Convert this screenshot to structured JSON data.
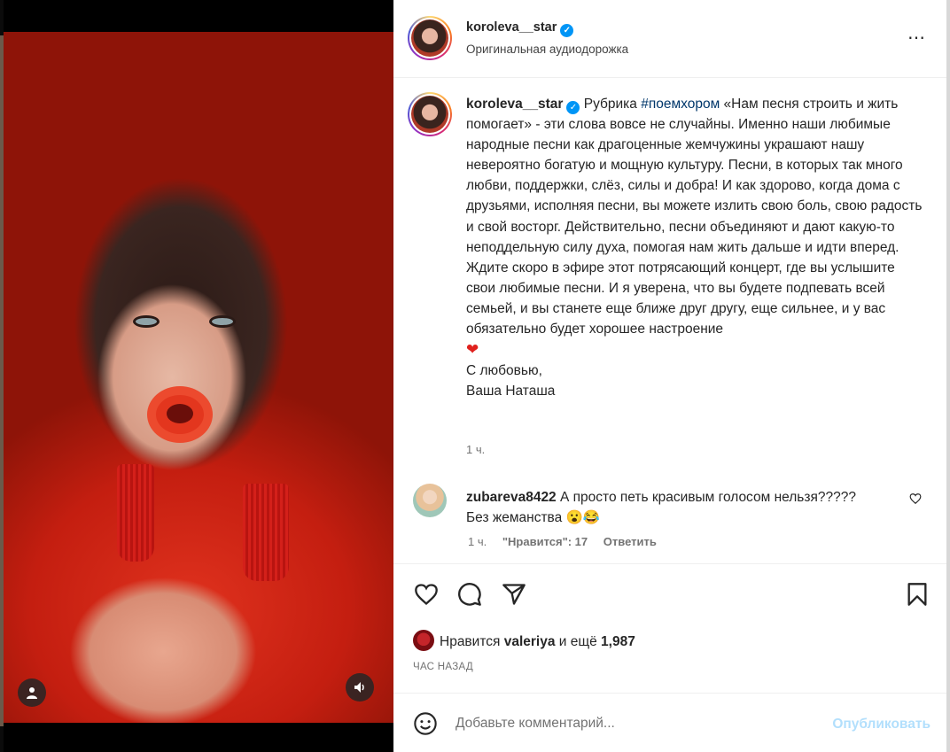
{
  "media": {
    "user_button_icon": "person-icon",
    "sound_button_icon": "speaker-icon"
  },
  "header": {
    "username": "koroleva__star",
    "verified_icon": "verified-badge-icon",
    "audio": "Оригинальная аудиодорожка",
    "more_icon": "more-options-icon",
    "more": "⋯"
  },
  "caption": {
    "username": "koroleva__star",
    "text_before_hashtag": "Рубрика ",
    "hashtag": "#поемхором",
    "text_after_hashtag": " «Нам песня строить и жить помогает» - эти слова вовсе не случайны. Именно наши любимые народные песни как драгоценные жемчужины украшают нашу невероятно богатую и мощную культуру. Песни, в которых так много любви, поддержки, слёз, силы и добра! И как здорово, когда дома с друзьями, исполняя песни, вы можете излить свою боль, свою радость и свой восторг. Действительно, песни объединяют и дают какую-то неподдельную силу духа, помогая нам жить дальше и идти вперед.",
    "paragraph2": "Ждите скоро в эфире этот потрясающий концерт, где вы услышите свои любимые песни. И я уверена, что вы будете подпевать всей семьей, и вы станете еще ближе друг другу, еще сильнее, и у вас обязательно будет хорошее настроение",
    "heart_emoji": "❤",
    "signoff1": "С любовью,",
    "signoff2": "Ваша Наташа",
    "time": "1 ч."
  },
  "comment": {
    "username": "zubareva8422",
    "text": "А просто петь красивым голосом нельзя?????",
    "text2": "Без жеманства 😮😂",
    "time": "1 ч.",
    "likes": "\"Нравится\": 17",
    "reply": "Ответить",
    "like_icon": "heart-outline-icon"
  },
  "actions": {
    "like_icon": "heart-icon",
    "comment_icon": "comment-icon",
    "share_icon": "share-icon",
    "save_icon": "bookmark-icon",
    "likes_prefix": "Нравится ",
    "likes_user": "valeriya",
    "likes_middle": " и ещё ",
    "likes_count": "1,987",
    "time_ago": "ЧАС НАЗАД"
  },
  "add_comment": {
    "emoji_icon": "emoji-icon",
    "placeholder": "Добавьте комментарий...",
    "post_label": "Опубликовать"
  }
}
